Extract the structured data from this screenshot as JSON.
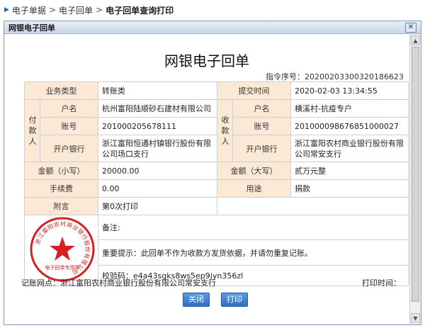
{
  "breadcrumb": {
    "items": [
      "电子单据",
      "电子回单"
    ],
    "current": "电子回单查询打印",
    "separator": ">"
  },
  "dialog": {
    "title": "网银电子回单",
    "close_glyph": "✕"
  },
  "receipt": {
    "title": "网银电子回单",
    "serial_label": "指令序号：",
    "serial_value": "20200203300320186623",
    "labels": {
      "biz_type": "业务类型",
      "submit_time": "提交时间",
      "payer_side": "付款人",
      "payee_side": "收款人",
      "name": "户名",
      "account": "账号",
      "bank": "开户银行",
      "amount_small": "金额（小写）",
      "amount_big": "金额（大写）",
      "fee": "手续费",
      "purpose": "用途",
      "postscript": "附言"
    },
    "values": {
      "biz_type": "转账类",
      "submit_time": "2020-02-03 13:34:55",
      "payer_name": "杭州富阳陆顺砂石建材有限公司",
      "payee_name": "横溪村-抗疫专户",
      "payer_account": "201000205678111",
      "payee_account": "201000098676851000027",
      "payer_bank": "浙江富阳恒通村镇银行股份有限公司场口支行",
      "payee_bank": "浙江富阳农村商业银行股份有限公司常安支行",
      "amount_small": "20000.00",
      "amount_big": "贰万元整",
      "fee": "0.00",
      "purpose": "捐款",
      "postscript": "第0次打印"
    },
    "notes": {
      "remark": "备注:",
      "warning": "重要提示：此回单不作为收款方发货依据，并请勿重复记账。",
      "checkcode": "校验码：e4a43sgks8ws5ep9jyn356zl"
    },
    "seal": {
      "ring_text": "浙江富阳农村商业银行股份有限公司",
      "bottom_text": "电子回单专用章",
      "color": "#d42020"
    },
    "footer": {
      "branch": "记账网点：浙江富阳农村商业银行股份有限公司常安支行",
      "print_time": "打印时间："
    }
  },
  "buttons": {
    "close": "关闭",
    "print": "打印"
  },
  "colors": {
    "label_bg": "#fbe9d5",
    "button": "#3a7fd0"
  }
}
